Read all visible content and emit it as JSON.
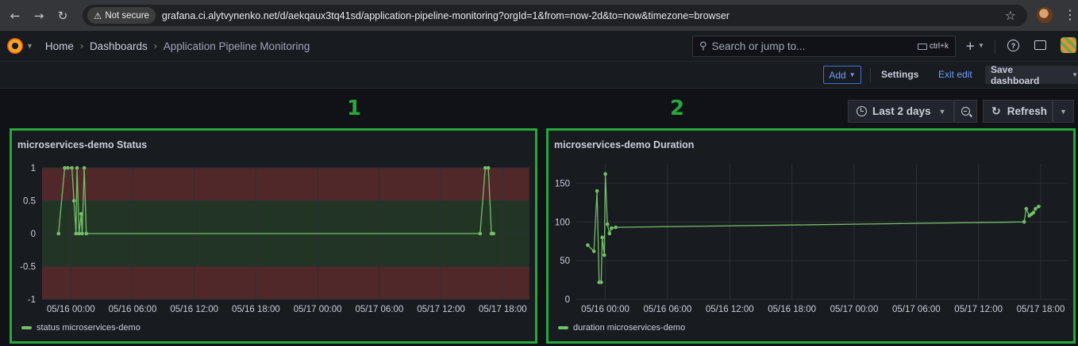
{
  "browser": {
    "not_secure_label": "Not secure",
    "url": "grafana.ci.alytvynenko.net/d/aekqaux3tq41sd/application-pipeline-monitoring?orgId=1&from=now-2d&to=now&timezone=browser"
  },
  "nav": {
    "breadcrumbs": [
      "Home",
      "Dashboards",
      "Application Pipeline Monitoring"
    ],
    "search_placeholder": "Search or jump to...",
    "search_shortcut": "ctrl+k"
  },
  "toolbar": {
    "add_label": "Add",
    "settings_label": "Settings",
    "exit_label": "Exit edit",
    "save_label": "Save dashboard"
  },
  "controls": {
    "time_range": "Last 2 days",
    "refresh_label": "Refresh"
  },
  "annotations": [
    "1",
    "2"
  ],
  "colors": {
    "annotation_green": "#27a83a",
    "series_green": "#73bf69",
    "threshold_red": "#5c2a2c",
    "threshold_green": "#243a27",
    "link_blue": "#6e9fff"
  },
  "chart_data": [
    {
      "type": "line",
      "title": "microservices-demo Status",
      "xlabel": "",
      "ylabel": "",
      "x_ticks": [
        "05/16 00:00",
        "05/16 06:00",
        "05/16 12:00",
        "05/16 18:00",
        "05/17 00:00",
        "05/17 06:00",
        "05/17 12:00",
        "05/17 18:00"
      ],
      "y_ticks": [
        "1",
        "0.5",
        "0",
        "-0.5",
        "-1"
      ],
      "ylim": [
        -1,
        1
      ],
      "xlim_hours": [
        -2.8,
        44.6
      ],
      "thresholds": [
        {
          "from": 0.5,
          "to": 1,
          "color": "red"
        },
        {
          "from": -0.5,
          "to": 0.5,
          "color": "green"
        },
        {
          "from": -1,
          "to": -0.5,
          "color": "red"
        }
      ],
      "series": [
        {
          "name": "status microservices-demo",
          "x_hours": [
            -1.2,
            -0.6,
            -0.3,
            0.1,
            0.3,
            0.5,
            0.6,
            0.8,
            1.0,
            1.1,
            1.3,
            1.5,
            39.8,
            40.3,
            40.6,
            40.9,
            41.1
          ],
          "values": [
            0,
            1,
            1,
            1,
            0.5,
            0,
            1,
            0,
            0.3,
            0,
            1,
            0,
            0,
            1,
            1,
            0,
            0
          ]
        }
      ]
    },
    {
      "type": "line",
      "title": "microservices-demo Duration",
      "xlabel": "",
      "ylabel": "",
      "x_ticks": [
        "05/16 00:00",
        "05/16 06:00",
        "05/16 12:00",
        "05/16 18:00",
        "05/17 00:00",
        "05/17 06:00",
        "05/17 12:00",
        "05/17 18:00"
      ],
      "y_ticks": [
        "150",
        "100",
        "50",
        "0"
      ],
      "ylim": [
        0,
        175
      ],
      "xlim_hours": [
        -2.8,
        44.6
      ],
      "series": [
        {
          "name": "duration microservices-demo",
          "x_hours": [
            -1.7,
            -1.1,
            -0.8,
            -0.6,
            -0.4,
            -0.3,
            -0.1,
            0.0,
            0.2,
            0.4,
            0.6,
            1.0,
            40.4,
            40.6,
            40.9,
            41.1,
            41.3,
            41.5,
            41.8
          ],
          "values": [
            70,
            62,
            140,
            22,
            22,
            80,
            57,
            162,
            97,
            85,
            92,
            93,
            100,
            117,
            108,
            110,
            112,
            117,
            120
          ]
        }
      ]
    }
  ]
}
